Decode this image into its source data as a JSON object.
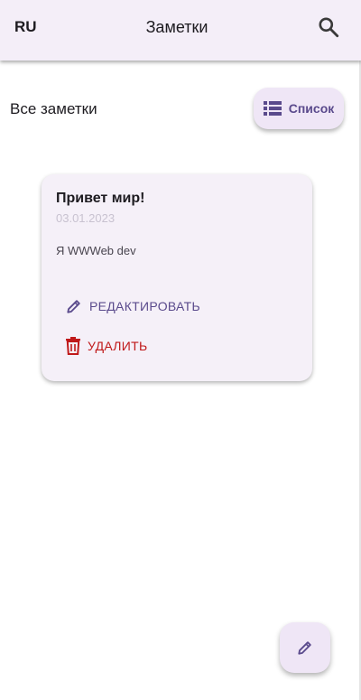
{
  "appbar": {
    "lang": "RU",
    "title": "Заметки",
    "search_icon": "search-icon"
  },
  "section": {
    "title": "Все заметки",
    "view_toggle": {
      "icon": "list-icon",
      "label": "Список"
    }
  },
  "notes": [
    {
      "title": "Привет мир!",
      "date": "03.01.2023",
      "body": "Я WWWeb dev",
      "edit_label": "РЕДАКТИРОВАТЬ",
      "delete_label": "УДАЛИТЬ"
    }
  ],
  "fab": {
    "icon": "pencil-icon"
  },
  "colors": {
    "appbar_bg": "#f4eef8",
    "card_bg": "#f5f0f8",
    "accent": "#5a4a8c",
    "danger": "#c0191a"
  }
}
